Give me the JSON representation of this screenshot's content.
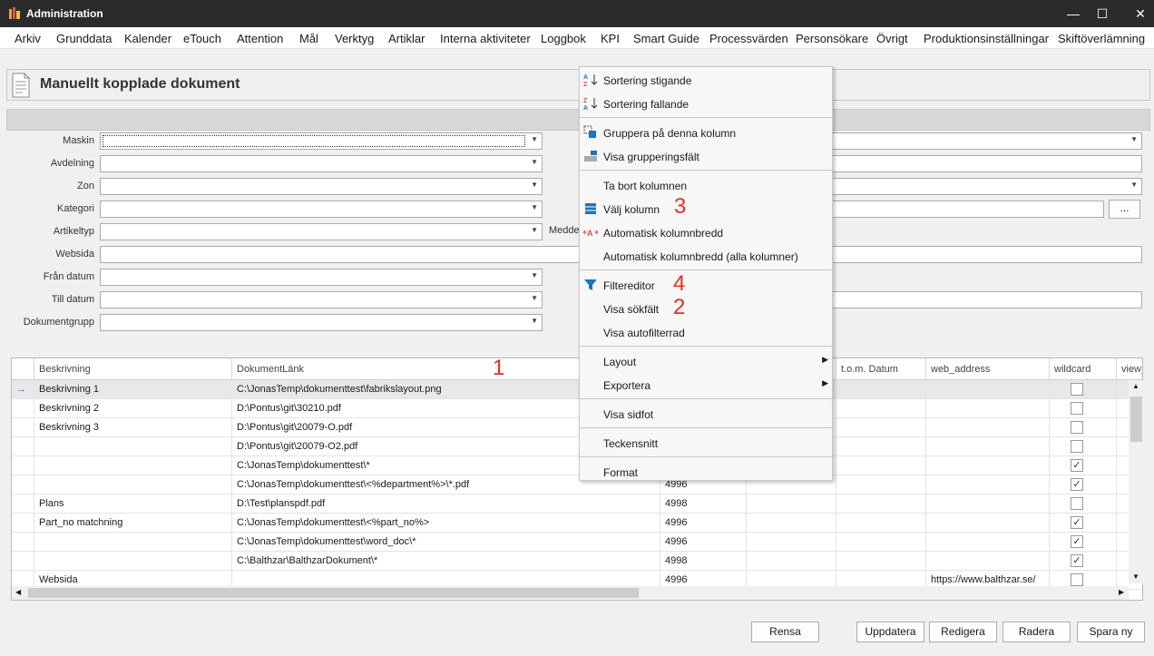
{
  "window": {
    "title": "Administration"
  },
  "menubar": [
    "Arkiv",
    "Grunddata",
    "Kalender",
    "eTouch",
    "Attention",
    "Mål",
    "Verktyg",
    "Artiklar",
    "Interna aktiviteter",
    "Loggbok",
    "KPI",
    "Smart Guide",
    "Processvärden",
    "Personsökare",
    "Övrigt",
    "Produktionsinställningar",
    "Skiftöverlämning"
  ],
  "page": {
    "title": "Manuellt kopplade dokument"
  },
  "filters": {
    "maskin": "Maskin",
    "avdelning": "Avdelning",
    "zon": "Zon",
    "kategori": "Kategori",
    "artikeltyp": "Artikeltyp",
    "websida": "Websida",
    "fran_datum": "Från datum",
    "till_datum": "Till datum",
    "dokumentgrupp": "Dokumentgrupp",
    "medde": "Medde",
    "ellipsis": "..."
  },
  "grid": {
    "columns": {
      "beskrivning": "Beskrivning",
      "dokumentlank": "DokumentLänk",
      "tom_datum": "t.o.m. Datum",
      "web_address": "web_address",
      "wildcard": "wildcard",
      "view": "view_"
    },
    "rows": [
      {
        "beskrivning": "Beskrivning 1",
        "lank": "C:\\JonasTemp\\dokumenttest\\fabrikslayout.png",
        "num": "",
        "web": "",
        "wildcard": false
      },
      {
        "beskrivning": "Beskrivning 2",
        "lank": "D:\\Pontus\\git\\30210.pdf",
        "num": "",
        "web": "",
        "wildcard": false
      },
      {
        "beskrivning": "Beskrivning 3",
        "lank": "D:\\Pontus\\git\\20079-O.pdf",
        "num": "",
        "web": "",
        "wildcard": false
      },
      {
        "beskrivning": "",
        "lank": "D:\\Pontus\\git\\20079-O2.pdf",
        "num": "",
        "web": "",
        "wildcard": false
      },
      {
        "beskrivning": "",
        "lank": "C:\\JonasTemp\\dokumenttest\\*",
        "num": "",
        "web": "",
        "wildcard": true
      },
      {
        "beskrivning": "",
        "lank": "C:\\JonasTemp\\dokumenttest\\<%department%>\\*.pdf",
        "num": "4996",
        "web": "",
        "wildcard": true
      },
      {
        "beskrivning": "Plans",
        "lank": "D:\\Test\\planspdf.pdf",
        "num": "4998",
        "web": "",
        "wildcard": false
      },
      {
        "beskrivning": "Part_no matchning",
        "lank": "C:\\JonasTemp\\dokumenttest\\<%part_no%>",
        "num": "4996",
        "web": "",
        "wildcard": true
      },
      {
        "beskrivning": "",
        "lank": "C:\\JonasTemp\\dokumenttest\\word_doc\\*",
        "num": "4996",
        "web": "",
        "wildcard": true
      },
      {
        "beskrivning": "",
        "lank": "C:\\Balthzar\\BalthzarDokument\\*",
        "num": "4998",
        "web": "",
        "wildcard": true
      },
      {
        "beskrivning": "Websida",
        "lank": "",
        "num": "4996",
        "web": "https://www.balthzar.se/",
        "wildcard": false
      }
    ]
  },
  "buttons": {
    "rensa": "Rensa",
    "uppdatera": "Uppdatera",
    "redigera": "Redigera",
    "radera": "Radera",
    "spara_ny": "Spara ny"
  },
  "context_menu": {
    "sort_asc": "Sortering stigande",
    "sort_desc": "Sortering fallande",
    "group": "Gruppera på denna kolumn",
    "show_group": "Visa grupperingsfält",
    "remove_col": "Ta bort kolumnen",
    "choose_col": "Välj kolumn",
    "auto_width": "Automatisk kolumnbredd",
    "auto_width_all": "Automatisk kolumnbredd (alla kolumner)",
    "filter_editor": "Filtereditor",
    "show_search": "Visa sökfält",
    "show_autofilter": "Visa autofilterrad",
    "layout": "Layout",
    "export": "Exportera",
    "show_footer": "Visa sidfot",
    "font": "Teckensnitt",
    "format": "Format"
  },
  "annotations": {
    "a1": "1",
    "a2": "2",
    "a3": "3",
    "a4": "4"
  },
  "colors": {
    "titlebar": "#2b2b2b",
    "accent_icon": "#1e73be",
    "annotation": "#e0302a"
  }
}
